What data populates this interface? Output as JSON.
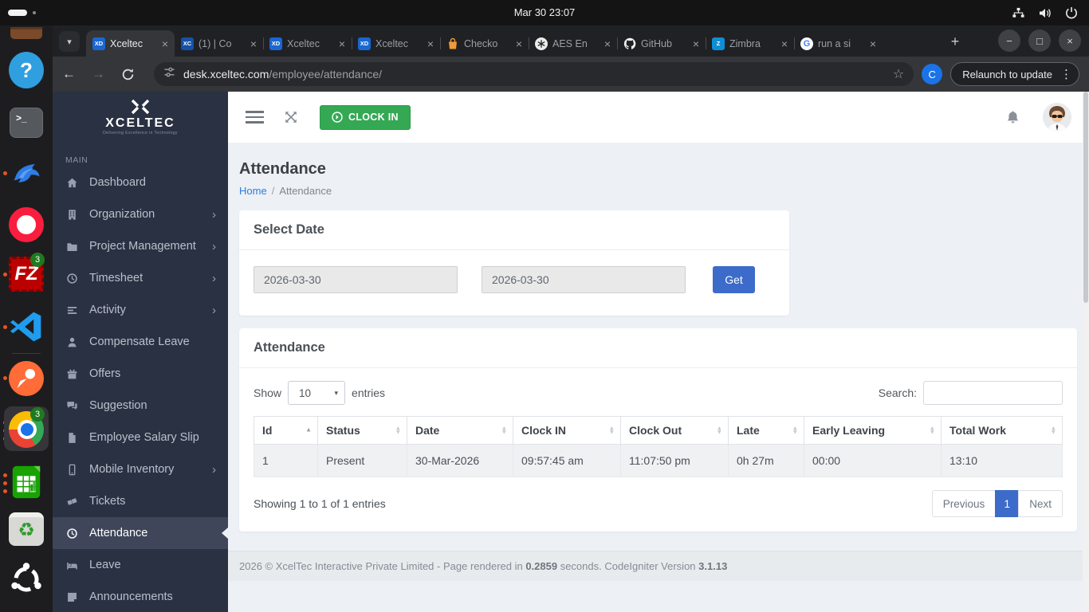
{
  "system_bar": {
    "clock": "Mar 30 23:07"
  },
  "icons": {
    "caret_down": "▾",
    "sort_up": "▲",
    "sort_down": "▼",
    "kebab": "⋮",
    "star": "☆",
    "back": "←",
    "forward": "→",
    "close": "×",
    "plus": "+",
    "minimize": "−",
    "maximize": "□"
  },
  "dock": {
    "help_glyph": "?",
    "terminal_glyph": ">_",
    "filezilla_glyph": "FZ",
    "recycle_glyph": "♻",
    "badges": {
      "filezilla": "3",
      "chrome": "3"
    }
  },
  "browser": {
    "tabs": [
      {
        "favicon_text": "XD",
        "label": "Xceltec"
      },
      {
        "favicon_text": "XC",
        "label": "(1) | Co"
      },
      {
        "favicon_text": "XD",
        "label": "Xceltec"
      },
      {
        "favicon_text": "XD",
        "label": "Xceltec"
      },
      {
        "label": "Checko"
      },
      {
        "label": "AES En"
      },
      {
        "label": "GitHub"
      },
      {
        "favicon_text": "Z",
        "label": "Zimbra"
      },
      {
        "favicon_text": "G",
        "label": "run a si"
      }
    ],
    "url": {
      "host": "desk.xceltec.com",
      "path": "/employee/attendance/"
    },
    "profile_initial": "C",
    "relaunch_label": "Relaunch to update"
  },
  "colors": {
    "accent_green": "#35a854",
    "accent_blue": "#3c6bc9",
    "link_blue": "#2b7be0",
    "sidebar_bg": "#2a3142"
  },
  "app": {
    "logo": {
      "brand": "XCELTEC",
      "tagline": "Delivering Excellence in Technology"
    },
    "header": {
      "clock_in": "CLOCK IN"
    },
    "sidebar": {
      "section": "MAIN",
      "items": [
        {
          "label": "Dashboard"
        },
        {
          "label": "Organization",
          "chevron": "›"
        },
        {
          "label": "Project Management",
          "chevron": "›"
        },
        {
          "label": "Timesheet",
          "chevron": "›"
        },
        {
          "label": "Activity",
          "chevron": "›"
        },
        {
          "label": "Compensate Leave"
        },
        {
          "label": "Offers"
        },
        {
          "label": "Suggestion"
        },
        {
          "label": "Employee Salary Slip"
        },
        {
          "label": "Mobile Inventory",
          "chevron": "›"
        },
        {
          "label": "Tickets"
        },
        {
          "label": "Attendance",
          "active": true
        },
        {
          "label": "Leave"
        },
        {
          "label": "Announcements"
        }
      ]
    },
    "page": {
      "title": "Attendance",
      "breadcrumb": {
        "home": "Home",
        "separator": "/",
        "current": "Attendance"
      },
      "select_date": {
        "title": "Select Date",
        "from": "2026-03-30",
        "to": "2026-03-30",
        "get": "Get"
      },
      "attendance": {
        "title": "Attendance",
        "show": "Show",
        "entries": "entries",
        "page_length": "10",
        "search": "Search:",
        "columns": [
          "Id",
          "Status",
          "Date",
          "Clock IN",
          "Clock Out",
          "Late",
          "Early Leaving",
          "Total Work"
        ],
        "row": [
          "1",
          "Present",
          "30-Mar-2026",
          "09:57:45 am",
          "11:07:50 pm",
          "0h 27m",
          "00:00",
          "13:10"
        ],
        "info": "Showing 1 to 1 of 1 entries",
        "pagination": {
          "previous": "Previous",
          "current": "1",
          "next": "Next"
        }
      },
      "footer": {
        "prefix": "2026 © XcelTec Interactive Private Limited - Page rendered in ",
        "seconds": "0.2859",
        "middle": " seconds. CodeIgniter Version ",
        "version": "3.1.13"
      }
    }
  }
}
